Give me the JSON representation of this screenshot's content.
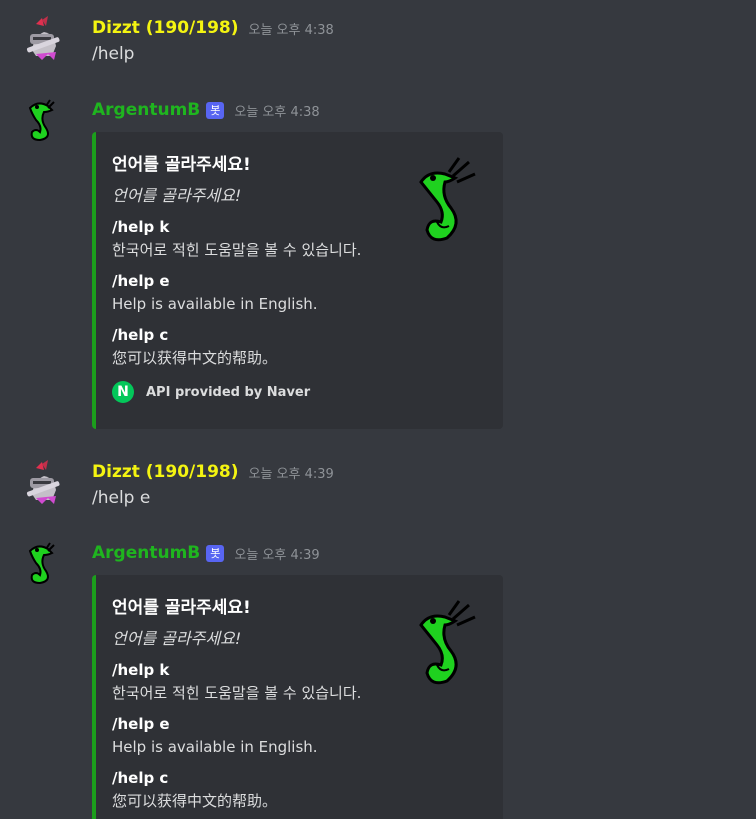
{
  "messages": [
    {
      "username": "Dizzt (190/198)",
      "timestamp": "오늘 오후 4:38",
      "content": "/help"
    },
    {
      "username": "ArgentumB",
      "badge": "봇",
      "timestamp": "오늘 오후 4:38",
      "embed": {
        "title": "언어를 골라주세요!",
        "description": "언어를 골라주세요!",
        "fields": [
          {
            "name": "/help k",
            "value": "한국어로 적힌 도움말을 볼 수 있습니다."
          },
          {
            "name": "/help e",
            "value": "Help is available in English."
          },
          {
            "name": "/help c",
            "value": "您可以获得中文的帮助。"
          }
        ],
        "footer_icon": "N",
        "footer_text": "API provided by Naver",
        "color": "#1c9e1c"
      }
    },
    {
      "username": "Dizzt (190/198)",
      "timestamp": "오늘 오후 4:39",
      "content": "/help e"
    },
    {
      "username": "ArgentumB",
      "badge": "봇",
      "timestamp": "오늘 오후 4:39",
      "embed": {
        "title": "언어를 골라주세요!",
        "description": "언어를 골라주세요!",
        "fields": [
          {
            "name": "/help k",
            "value": "한국어로 적힌 도움말을 볼 수 있습니다."
          },
          {
            "name": "/help e",
            "value": "Help is available in English."
          },
          {
            "name": "/help c",
            "value": "您可以获得中文的帮助。"
          }
        ],
        "color": "#1c9e1c"
      }
    }
  ],
  "icons": {
    "user_avatar": "knight-avatar-icon",
    "bot_avatar": "green-dragon-avatar-icon",
    "thumbnail": "green-dragon-thumbnail-icon",
    "footer": "naver-logo-icon"
  },
  "colors": {
    "background": "#36393f",
    "embed_background": "#2f3136",
    "user_name": "#f4f411",
    "bot_name": "#1fb51f",
    "bot_badge": "#5865f2",
    "naver_green": "#03c75a"
  }
}
